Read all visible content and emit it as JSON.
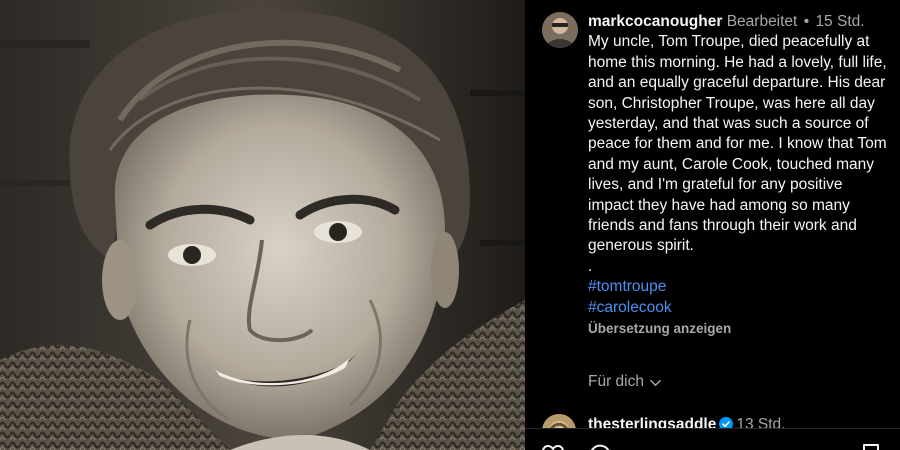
{
  "post": {
    "username": "markcocanougher",
    "edited": "Bearbeitet",
    "separator": "•",
    "time": "15 Std.",
    "caption": "My uncle, Tom Troupe, died peacefully at home this morning. He had a lovely, full life, and an equally graceful departure. His dear son, Christopher Troupe, was here all day yesterday, and that was such a source of peace for them and for me. I know that Tom and my aunt, Carole Cook, touched many lives, and I'm grateful for any positive impact they have had among so many friends and fans through their work and generous spirit.",
    "period": ".",
    "hashtags": [
      "#tomtroupe",
      "#carolecook"
    ],
    "translate_label": "Übersetzung anzeigen"
  },
  "for_you_label": "Für dich",
  "comment": {
    "username": "thesterlingsaddle",
    "time": "13 Std."
  },
  "icons": {
    "avatar": "profile-photo",
    "chevron": "chevron-down-icon",
    "verified": "verified-badge-icon",
    "like": "heart-icon",
    "comment": "comment-icon",
    "save": "bookmark-icon"
  }
}
